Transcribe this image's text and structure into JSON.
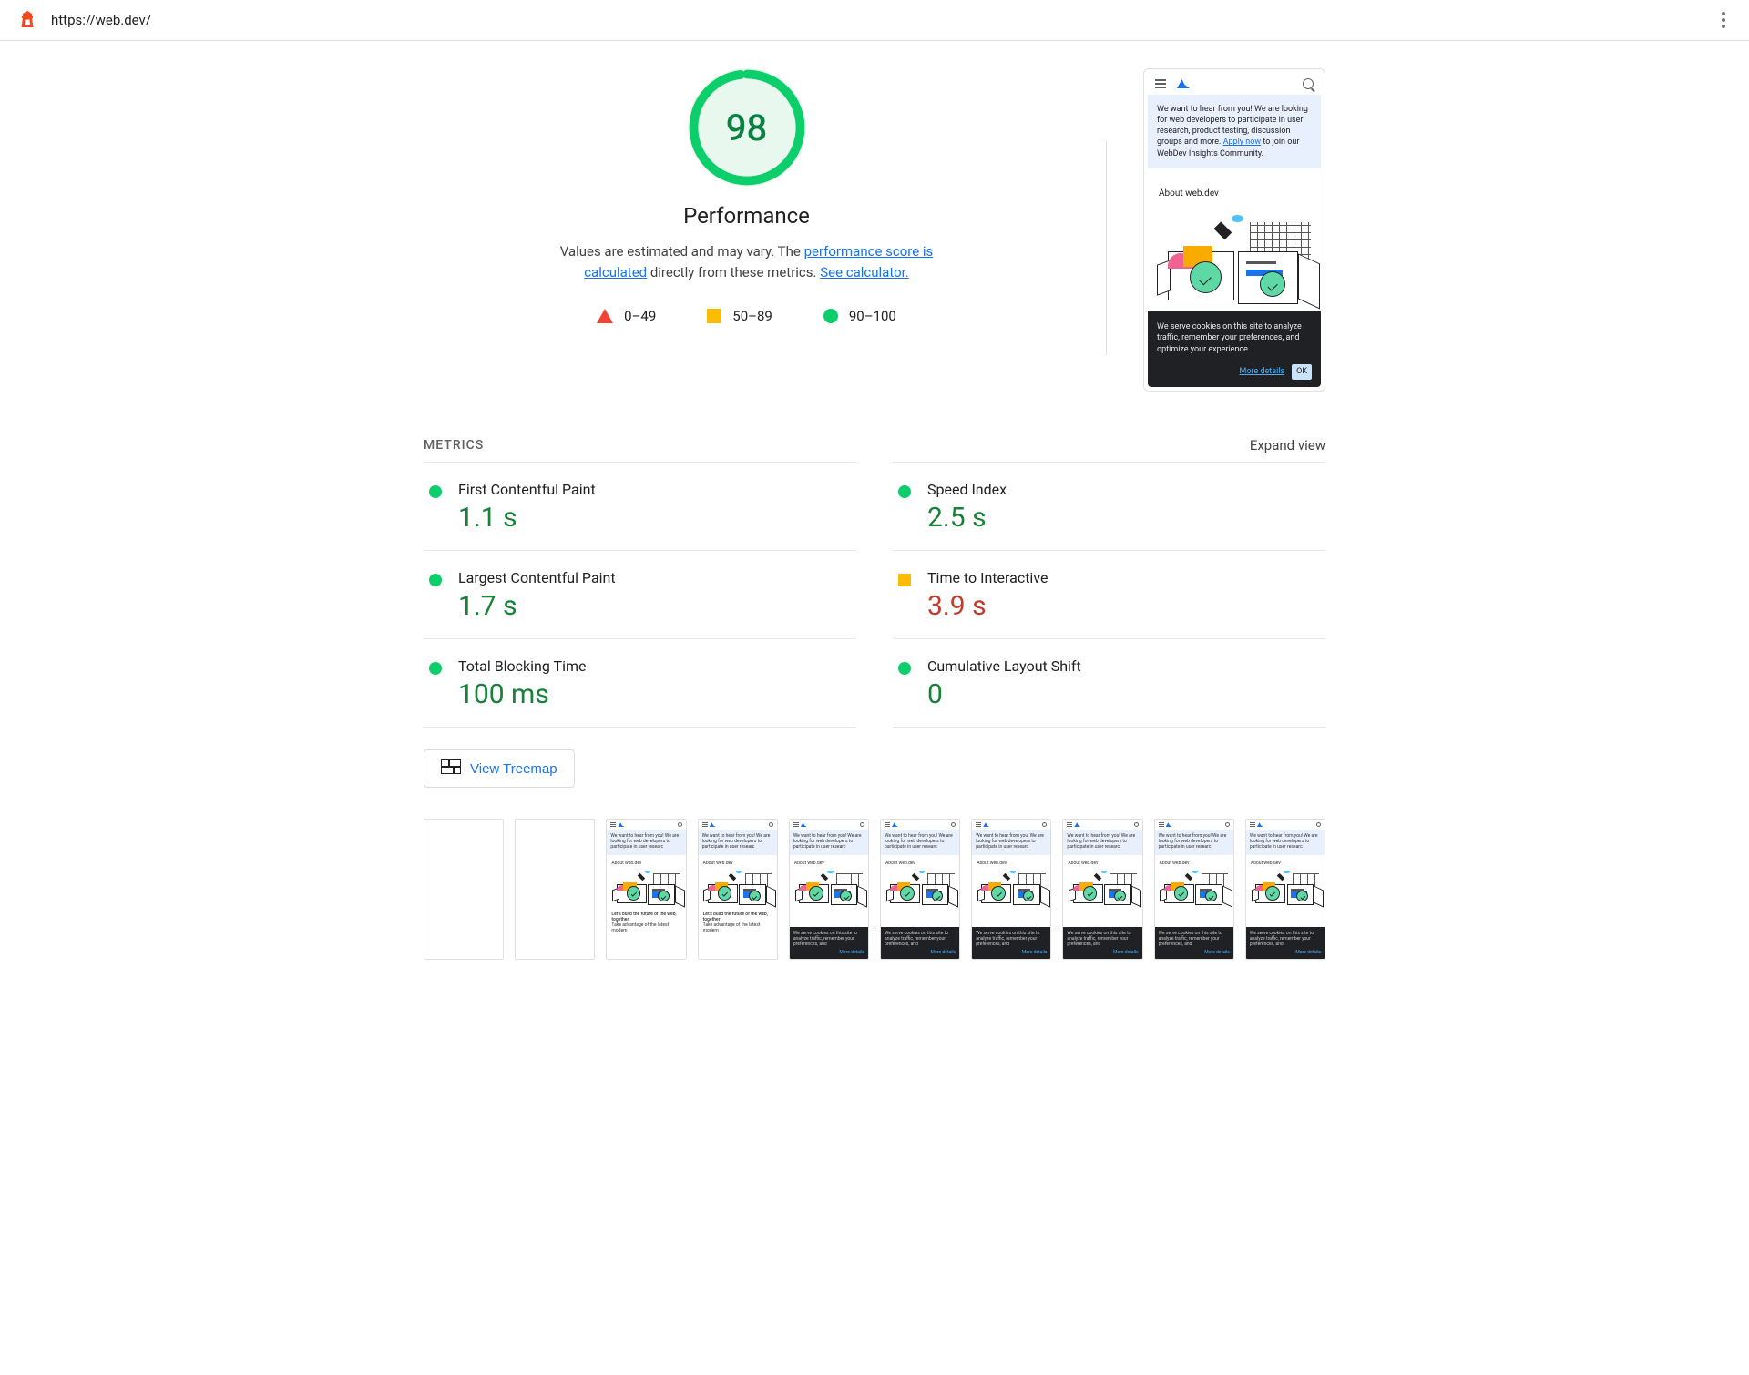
{
  "header": {
    "url": "https://web.dev/"
  },
  "performance": {
    "score": "98",
    "title": "Performance",
    "desc_prefix": "Values are estimated and may vary. The ",
    "link1": "performance score is calculated",
    "desc_mid": " directly from these metrics. ",
    "link2": "See calculator.",
    "legend": {
      "fail": "0–49",
      "avg": "50–89",
      "pass": "90–100"
    },
    "gauge_pct": 98
  },
  "preview": {
    "banner_text": "We want to hear from you! We are looking for web developers to participate in user research, product testing, discussion groups and more. ",
    "banner_link": "Apply now",
    "banner_suffix": " to join our WebDev Insights Community.",
    "about": "About web.dev",
    "cookie_text": "We serve cookies on this site to analyze traffic, remember your preferences, and optimize your experience.",
    "more_details": "More details",
    "ok": "OK"
  },
  "metrics": {
    "title": "METRICS",
    "expand": "Expand view",
    "items": [
      {
        "name": "First Contentful Paint",
        "value": "1.1 s",
        "status": "pass"
      },
      {
        "name": "Speed Index",
        "value": "2.5 s",
        "status": "pass"
      },
      {
        "name": "Largest Contentful Paint",
        "value": "1.7 s",
        "status": "pass"
      },
      {
        "name": "Time to Interactive",
        "value": "3.9 s",
        "status": "avg"
      },
      {
        "name": "Total Blocking Time",
        "value": "100 ms",
        "status": "pass"
      },
      {
        "name": "Cumulative Layout Shift",
        "value": "0",
        "status": "pass"
      }
    ]
  },
  "treemap": {
    "label": "View Treemap"
  },
  "filmstrip": {
    "frames": [
      {
        "state": "blank"
      },
      {
        "state": "blank"
      },
      {
        "state": "partial"
      },
      {
        "state": "partial"
      },
      {
        "state": "cookie"
      },
      {
        "state": "cookie"
      },
      {
        "state": "cookie"
      },
      {
        "state": "cookie"
      },
      {
        "state": "cookie"
      },
      {
        "state": "cookie"
      }
    ],
    "headline": "Let's build the future of the web, together",
    "sub": "Take advantage of the latest modern"
  },
  "colors": {
    "pass": "#0cce6b",
    "avg": "#fbbc04",
    "fail": "#f44336",
    "link": "#1a73e8"
  }
}
